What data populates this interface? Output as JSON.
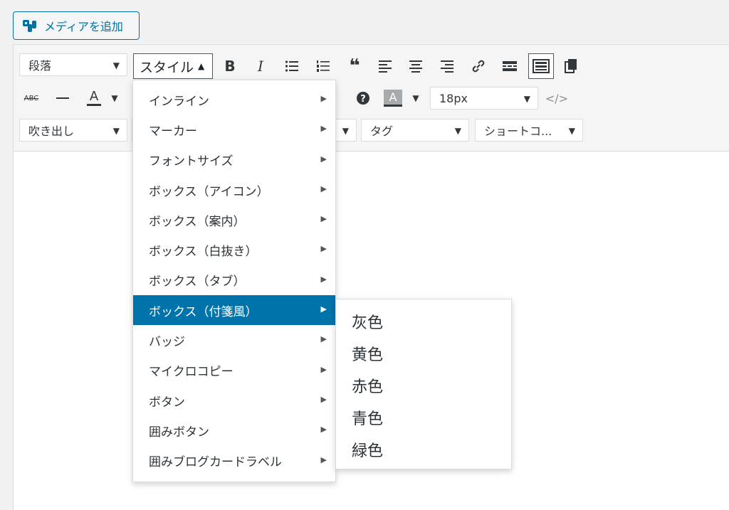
{
  "media_button": {
    "label": "メディアを追加"
  },
  "toolbar": {
    "format_select": "段落",
    "style_button": "スタイル",
    "fontsize_select": "18px",
    "balloon_select": "吹き出し",
    "tag_select": "タグ",
    "shortcode_select": "ショートコ...",
    "strike_label": "ABC",
    "forecolor_label": "A",
    "bgcolor_label": "A"
  },
  "style_menu": {
    "items": [
      {
        "label": "インライン"
      },
      {
        "label": "マーカー"
      },
      {
        "label": "フォントサイズ"
      },
      {
        "label": "ボックス（アイコン）"
      },
      {
        "label": "ボックス（案内）"
      },
      {
        "label": "ボックス（白抜き）"
      },
      {
        "label": "ボックス（タブ）"
      },
      {
        "label": "ボックス（付箋風）"
      },
      {
        "label": "バッジ"
      },
      {
        "label": "マイクロコピー"
      },
      {
        "label": "ボタン"
      },
      {
        "label": "囲みボタン"
      },
      {
        "label": "囲みブログカードラベル"
      }
    ],
    "active_index": 7
  },
  "submenu": {
    "items": [
      {
        "label": "灰色"
      },
      {
        "label": "黄色"
      },
      {
        "label": "赤色"
      },
      {
        "label": "青色"
      },
      {
        "label": "緑色"
      }
    ]
  },
  "colors": {
    "accent": "#0073aa",
    "button_border": "#0071a1"
  }
}
